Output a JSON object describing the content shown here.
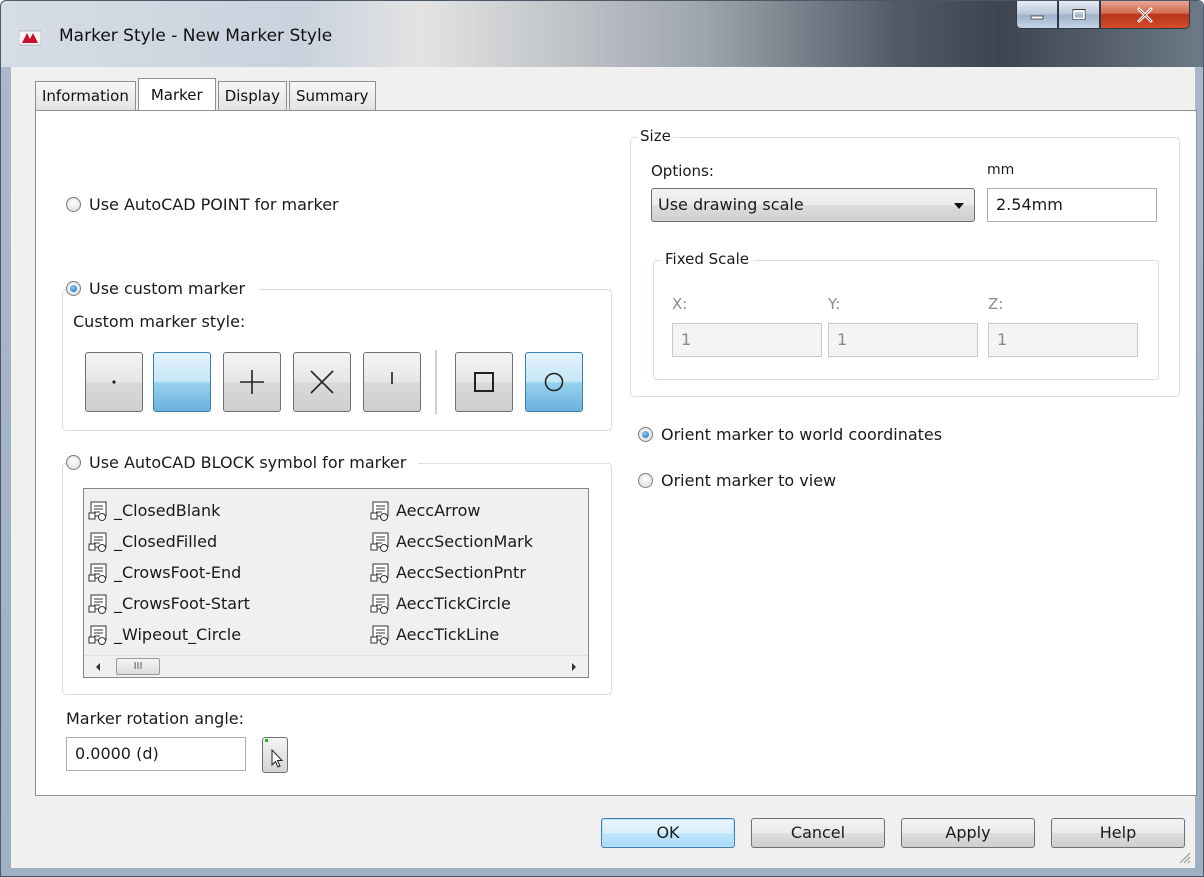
{
  "window": {
    "title": "Marker Style - New Marker Style"
  },
  "tabs": [
    {
      "label": "Information",
      "active": false
    },
    {
      "label": "Marker",
      "active": true
    },
    {
      "label": "Display",
      "active": false
    },
    {
      "label": "Summary",
      "active": false
    }
  ],
  "marker": {
    "point_option_label": "Use AutoCAD POINT for marker",
    "custom_option_label": "Use custom marker",
    "custom_style_label": "Custom marker style:",
    "custom_buttons": [
      {
        "icon": "dot-marker-icon",
        "selected": false
      },
      {
        "icon": "none-marker-icon",
        "selected": true
      },
      {
        "icon": "plus-marker-icon",
        "selected": false
      },
      {
        "icon": "x-marker-icon",
        "selected": false
      },
      {
        "icon": "tick-marker-icon",
        "selected": false
      },
      {
        "icon": "square-marker-icon",
        "selected": false
      },
      {
        "icon": "circle-marker-icon",
        "selected": true
      }
    ],
    "block_option_label": "Use AutoCAD BLOCK symbol for marker",
    "blocks_col1": [
      "_ClosedBlank",
      "_ClosedFilled",
      "_CrowsFoot-End",
      "_CrowsFoot-Start",
      "_Wipeout_Circle"
    ],
    "blocks_col2": [
      "AeccArrow",
      "AeccSectionMark",
      "AeccSectionPntr",
      "AeccTickCircle",
      "AeccTickLine"
    ],
    "scroll_grip": "III",
    "rotation_label": "Marker rotation angle:",
    "rotation_value": "0.0000 (d)",
    "selected_option": "custom"
  },
  "size": {
    "group_label": "Size",
    "options_label": "Options:",
    "unit_label": "mm",
    "options_value": "Use drawing scale",
    "size_value": "2.54mm",
    "fixed_scale_label": "Fixed Scale",
    "x_label": "X:",
    "y_label": "Y:",
    "z_label": "Z:",
    "x_value": "1",
    "y_value": "1",
    "z_value": "1"
  },
  "orient": {
    "world_label": "Orient marker to world coordinates",
    "view_label": "Orient marker to view",
    "selected": "world"
  },
  "buttons": {
    "ok": "OK",
    "cancel": "Cancel",
    "apply": "Apply",
    "help": "Help"
  },
  "colors": {
    "selected_button": "#98d1ef",
    "radio_checked": "#1d5da8",
    "close_button": "#c7442a"
  }
}
